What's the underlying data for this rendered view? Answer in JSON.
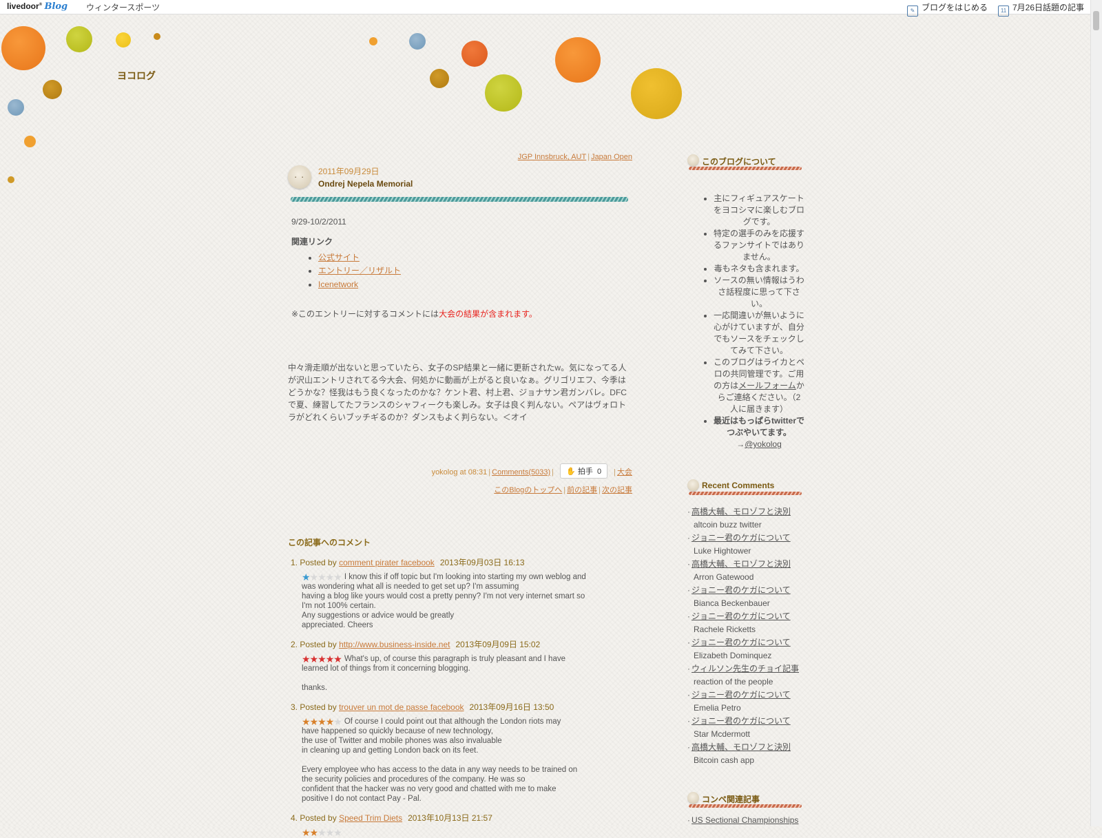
{
  "topbar": {
    "logo_text": "livedoor",
    "logo_blog": "Blog",
    "category": "ウィンタースポーツ",
    "start_blog": "ブログをはじめる",
    "trending": "7月26日話題の記事",
    "calendar_day": "11"
  },
  "blog": {
    "title": "ヨコログ"
  },
  "colors": {
    "accent": "#c87a3a",
    "heading": "#7a5a12",
    "highlight_red": "#e8231e",
    "link_blue": "#2a7fd0"
  },
  "entry": {
    "cat_link_1": "JGP Innsbruck, AUT",
    "cat_link_2": "Japan Open",
    "date": "2011年09月29日",
    "title": "Ondrej Nepela Memorial",
    "period": "9/29-10/2/2011",
    "related_heading": "関連リンク",
    "links": [
      "公式サイト",
      "エントリー／リザルト",
      "Icenetwork"
    ],
    "notice_prefix": "※このエントリーに対するコメントには",
    "notice_red": "大会の結果が含まれます",
    "notice_suffix": "。",
    "paragraph": "中々滑走順が出ないと思っていたら、女子のSP結果と一緒に更新されたw。気になってる人が沢山エントリされてる今大会、何処かに動画が上がると良いなぁ。グリゴリエフ、今季はどうかな？怪我はもう良くなったのかな？ケント君、村上君、ジョナサン君ガンバレ。DFCで夏、練習してたフランスのシャフィークも楽しみ。女子は良く判んない。ペアはヴォロトラがどれくらいブッチギるのか？ダンスもよく判らない。＜オイ",
    "footer_author": "yokolog at 08:31",
    "footer_comments": "Comments(5033)",
    "clap_label": "拍手",
    "clap_count": "0",
    "footer_category": "大会",
    "nav_top": "このBlogのトップへ",
    "nav_prev": "前の記事",
    "nav_next": "次の記事"
  },
  "comments": {
    "title": "この記事へのコメント",
    "items": [
      {
        "num": "1.",
        "posted_by": "Posted by",
        "author": "comment pirater facebook",
        "date": "2013年09月03日 16:13",
        "rating": 1,
        "text": "I know this if off topic but I'm looking into starting my own weblog and\nwas wondering what all is needed to get set up? I'm assuming\nhaving a blog like yours would cost a pretty penny? I'm not very internet smart so\nI'm not 100% certain.\nAny suggestions or advice would be greatly\nappreciated. Cheers"
      },
      {
        "num": "2.",
        "posted_by": "Posted by",
        "author": "http://www.business-inside.net",
        "date": "2013年09月09日 15:02",
        "rating": 5,
        "text": "What's up, of course this paragraph is truly pleasant and I have\nlearned lot of things from it concerning blogging.\n\nthanks."
      },
      {
        "num": "3.",
        "posted_by": "Posted by",
        "author": "trouver un mot de passe facebook",
        "date": "2013年09月16日 13:50",
        "rating": 4,
        "text": "Of course I could point out that although the London riots may\nhave happened so quickly because of new technology,\nthe use of Twitter and mobile phones was also invaluable\nin cleaning up and getting London back on its feet.\n\nEvery employee who has access to the data in any way needs to be trained on\nthe security policies and procedures of the company. He was so\nconfident that the hacker was no very good and chatted with me to make\npositive I do not contact Pay - Pal."
      },
      {
        "num": "4.",
        "posted_by": "Posted by",
        "author": "Speed Trim Diets",
        "date": "2013年10月13日 21:57",
        "rating": 2,
        "text": ""
      }
    ]
  },
  "sidebar": {
    "about_title": "このブログについて",
    "about_items": [
      "主にフィギュアスケートをヨコシマに楽しむブログです。",
      "特定の選手のみを応援するファンサイトではありません。",
      "毒もネタも含まれます。",
      "ソースの無い情報はうわさ話程度に思って下さい。",
      "一応間違いが無いように心がけていますが、自分でもソースをチェックしてみて下さい。"
    ],
    "about_joint_prefix": "このブログはライカとペロの共同管理です。ご用の方は",
    "about_joint_link": "メールフォーム",
    "about_joint_suffix": "からご連絡ください。（2人に届きます）",
    "about_twitter_bold": "最近はもっぱらtwitterでつぶやいてます。→",
    "about_twitter_link": "@yokolog",
    "recent_title": "Recent Comments",
    "recent": [
      {
        "post": "高橋大輔、モロゾフと決別",
        "by": "altcoin buzz twitter"
      },
      {
        "post": "ジョニー君のケガについて",
        "by": "Luke Hightower"
      },
      {
        "post": "高橋大輔、モロゾフと決別",
        "by": "Arron Gatewood"
      },
      {
        "post": "ジョニー君のケガについて",
        "by": "Bianca Beckenbauer"
      },
      {
        "post": "ジョニー君のケガについて",
        "by": "Rachele Ricketts"
      },
      {
        "post": "ジョニー君のケガについて",
        "by": "Elizabeth Dominquez"
      },
      {
        "post": "ウィルソン先生のチョイ記事",
        "by": "reaction of the people"
      },
      {
        "post": "ジョニー君のケガについて",
        "by": "Emelia Petro"
      },
      {
        "post": "ジョニー君のケガについて",
        "by": "Star Mcdermott"
      },
      {
        "post": "高橋大輔、モロゾフと決別",
        "by": "Bitcoin cash app"
      }
    ],
    "compe_title": "コンペ関連記事",
    "compe_first": "US Sectional Championships"
  }
}
